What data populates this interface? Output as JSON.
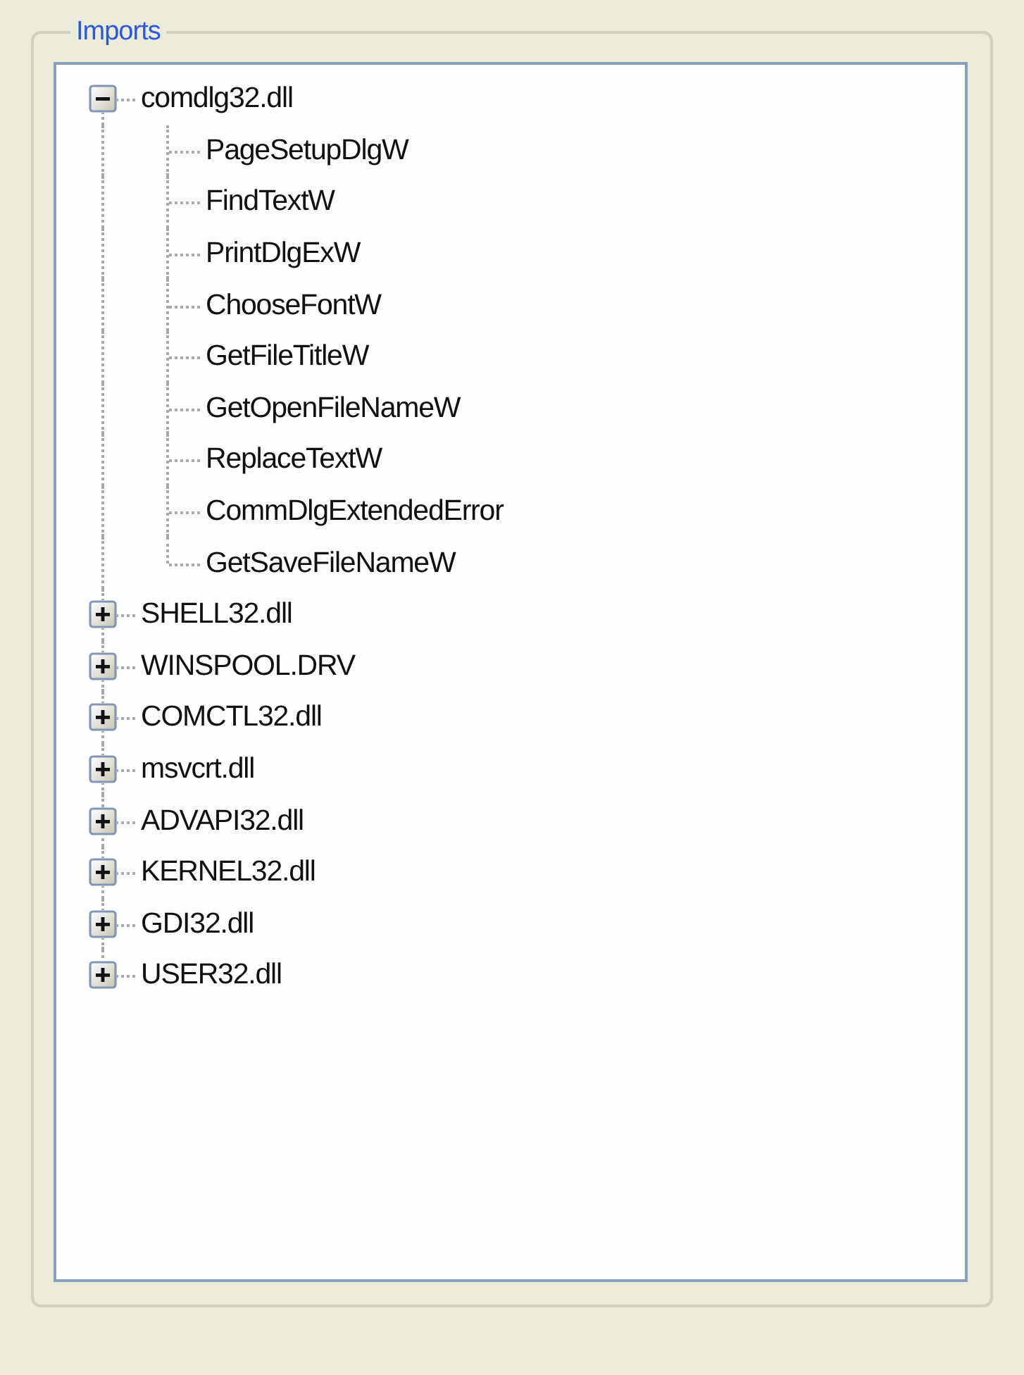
{
  "group": {
    "title": "Imports"
  },
  "tree": [
    {
      "label": "comdlg32.dll",
      "expanded": true,
      "children": [
        {
          "label": "PageSetupDlgW"
        },
        {
          "label": "FindTextW"
        },
        {
          "label": "PrintDlgExW"
        },
        {
          "label": "ChooseFontW"
        },
        {
          "label": "GetFileTitleW"
        },
        {
          "label": "GetOpenFileNameW"
        },
        {
          "label": "ReplaceTextW"
        },
        {
          "label": "CommDlgExtendedError"
        },
        {
          "label": "GetSaveFileNameW"
        }
      ]
    },
    {
      "label": "SHELL32.dll",
      "expanded": false
    },
    {
      "label": "WINSPOOL.DRV",
      "expanded": false
    },
    {
      "label": "COMCTL32.dll",
      "expanded": false
    },
    {
      "label": "msvcrt.dll",
      "expanded": false
    },
    {
      "label": "ADVAPI32.dll",
      "expanded": false
    },
    {
      "label": "KERNEL32.dll",
      "expanded": false
    },
    {
      "label": "GDI32.dll",
      "expanded": false
    },
    {
      "label": "USER32.dll",
      "expanded": false
    }
  ]
}
